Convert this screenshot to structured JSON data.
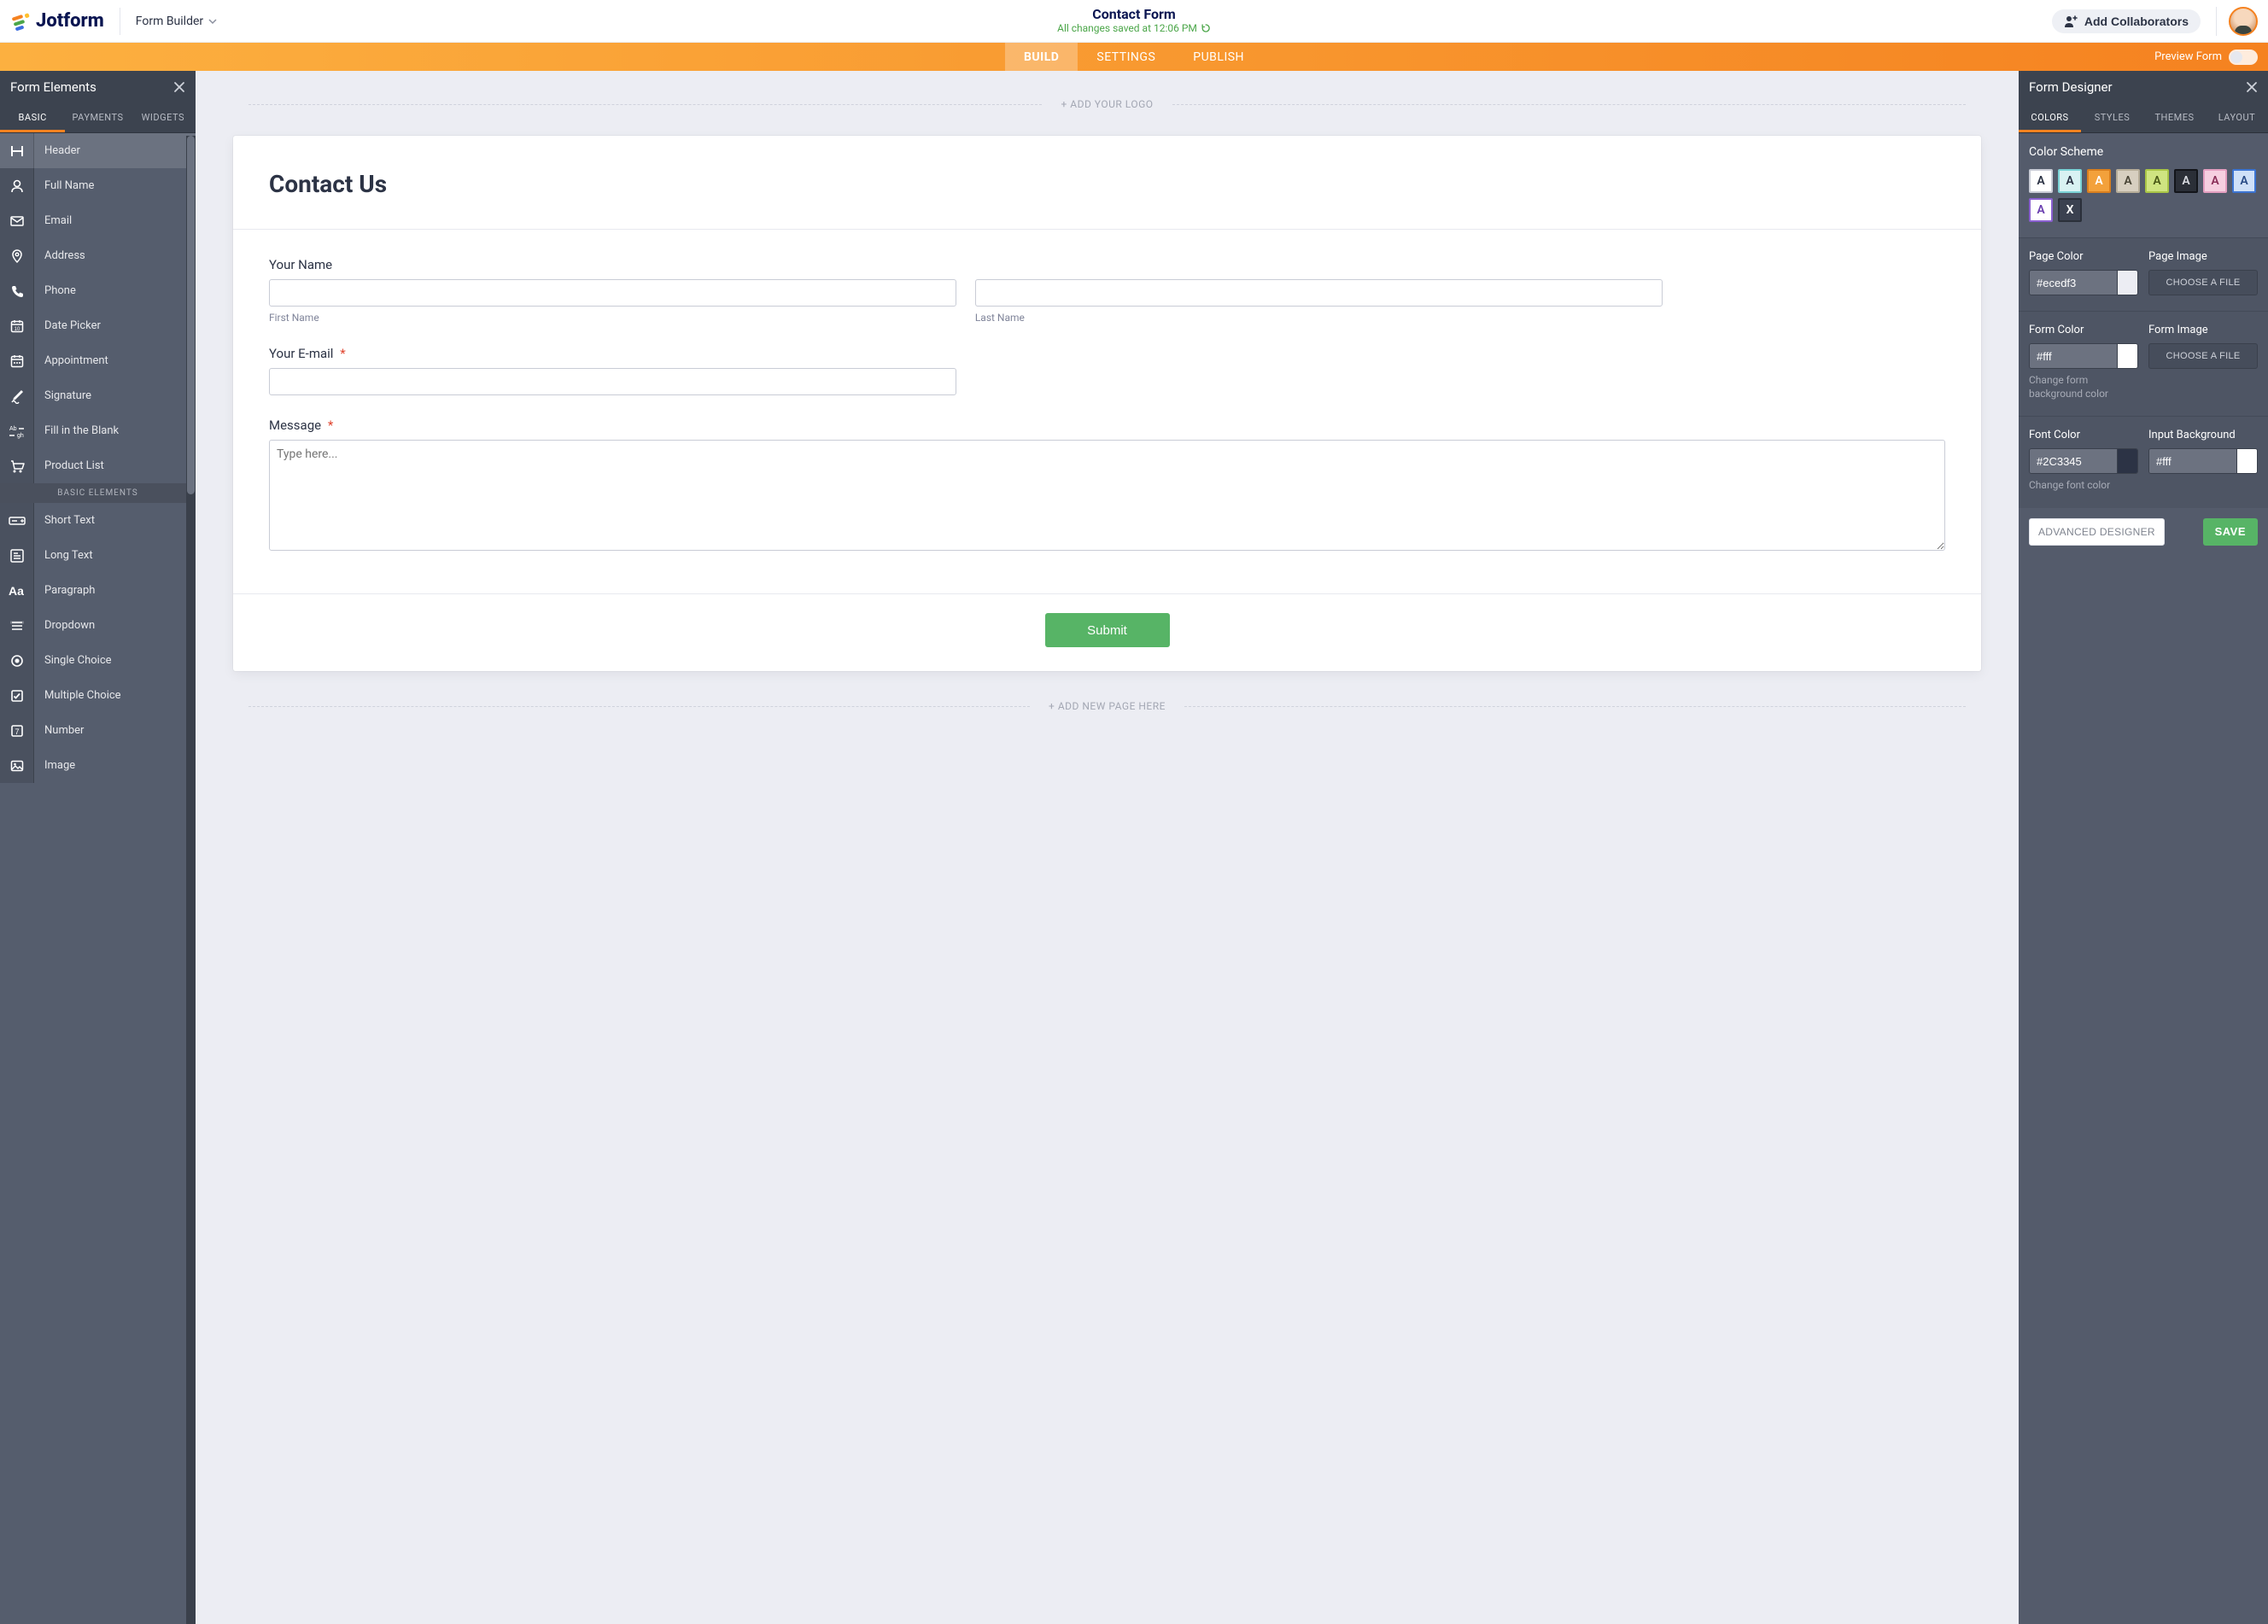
{
  "header": {
    "brand": "Jotform",
    "selector_label": "Form Builder",
    "title": "Contact Form",
    "saved_text": "All changes saved at 12:06 PM",
    "collab_label": "Add Collaborators"
  },
  "orange_nav": {
    "tabs": {
      "build": "BUILD",
      "settings": "SETTINGS",
      "publish": "PUBLISH"
    },
    "preview_label": "Preview Form"
  },
  "left_panel": {
    "title": "Form Elements",
    "tabs": {
      "basic": "BASIC",
      "payments": "PAYMENTS",
      "widgets": "WIDGETS"
    },
    "items_primary": [
      {
        "key": "header",
        "label": "Header"
      },
      {
        "key": "full-name",
        "label": "Full Name"
      },
      {
        "key": "email",
        "label": "Email"
      },
      {
        "key": "address",
        "label": "Address"
      },
      {
        "key": "phone",
        "label": "Phone"
      },
      {
        "key": "date-picker",
        "label": "Date Picker"
      },
      {
        "key": "appointment",
        "label": "Appointment"
      },
      {
        "key": "signature",
        "label": "Signature"
      },
      {
        "key": "fill-blank",
        "label": "Fill in the Blank"
      },
      {
        "key": "product-list",
        "label": "Product List"
      }
    ],
    "section_label": "BASIC ELEMENTS",
    "items_basic": [
      {
        "key": "short-text",
        "label": "Short Text"
      },
      {
        "key": "long-text",
        "label": "Long Text"
      },
      {
        "key": "paragraph",
        "label": "Paragraph"
      },
      {
        "key": "dropdown",
        "label": "Dropdown"
      },
      {
        "key": "single-choice",
        "label": "Single Choice"
      },
      {
        "key": "multiple-choice",
        "label": "Multiple Choice"
      },
      {
        "key": "number",
        "label": "Number"
      },
      {
        "key": "image",
        "label": "Image"
      }
    ]
  },
  "canvas": {
    "add_logo": "+ ADD YOUR LOGO",
    "form_title": "Contact Us",
    "fields": {
      "name_label": "Your Name",
      "first_sub": "First Name",
      "last_sub": "Last Name",
      "email_label": "Your E-mail",
      "message_label": "Message",
      "message_placeholder": "Type here..."
    },
    "submit_label": "Submit",
    "add_page": "+ ADD NEW PAGE HERE"
  },
  "right_panel": {
    "title": "Form Designer",
    "tabs": {
      "colors": "COLORS",
      "styles": "STYLES",
      "themes": "THEMES",
      "layout": "LAYOUT"
    },
    "scheme_title": "Color Scheme",
    "swatches": [
      {
        "bg": "#ffffff",
        "fg": "#2c3345",
        "border": "#c9ccd6",
        "glyph": "A"
      },
      {
        "bg": "#d9f2f3",
        "fg": "#2c3345",
        "border": "#7bd3d6",
        "glyph": "A"
      },
      {
        "bg": "#f3a13b",
        "fg": "#ffffff",
        "border": "#d97f1e",
        "glyph": "A"
      },
      {
        "bg": "#d7cfc0",
        "fg": "#4a4637",
        "border": "#b6ad99",
        "glyph": "A"
      },
      {
        "bg": "#cfe481",
        "fg": "#4b5a17",
        "border": "#a9c546",
        "glyph": "A"
      },
      {
        "bg": "#2b2f37",
        "fg": "#d7d9df",
        "border": "#13151a",
        "glyph": "A"
      },
      {
        "bg": "#f6cfe0",
        "fg": "#8a2f58",
        "border": "#e49fc0",
        "glyph": "A"
      },
      {
        "bg": "#cfe0f7",
        "fg": "#2a4c86",
        "border": "#3c74d1",
        "glyph": "A"
      },
      {
        "bg": "#ffffff",
        "fg": "#6a3fb0",
        "border": "#8a5fd0",
        "glyph": "A"
      },
      {
        "bg": "#3b4150",
        "fg": "#ffffff",
        "border": "#2b303a",
        "glyph": "X"
      }
    ],
    "page_color_label": "Page Color",
    "page_color_value": "#ecedf3",
    "page_image_label": "Page Image",
    "choose_file": "CHOOSE A FILE",
    "form_color_label": "Form Color",
    "form_color_value": "#fff",
    "form_image_label": "Form Image",
    "form_color_hint": "Change form background color",
    "font_color_label": "Font Color",
    "font_color_value": "#2C3345",
    "font_color_hint": "Change font color",
    "input_bg_label": "Input Background",
    "input_bg_value": "#fff",
    "advanced_label": "ADVANCED DESIGNER",
    "save_label": "SAVE"
  }
}
